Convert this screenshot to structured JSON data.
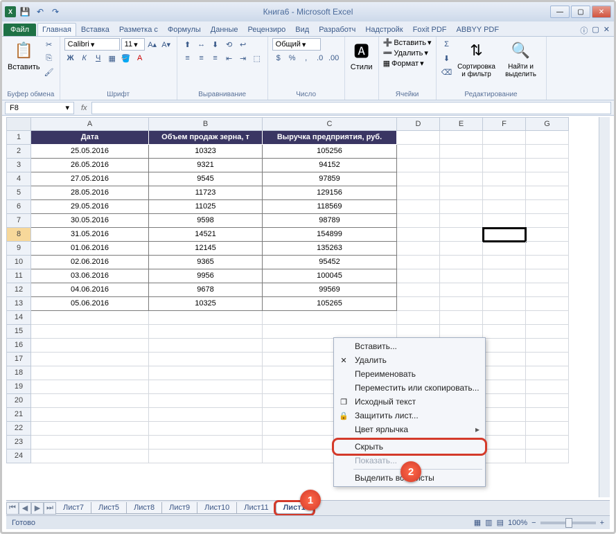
{
  "title": "Книга6 - Microsoft Excel",
  "tabs": {
    "file": "Файл",
    "list": [
      "Главная",
      "Вставка",
      "Разметка с",
      "Формулы",
      "Данные",
      "Рецензиро",
      "Вид",
      "Разработч",
      "Надстройк",
      "Foxit PDF",
      "ABBYY PDF"
    ],
    "active": 0
  },
  "ribbon": {
    "clipboard": {
      "paste": "Вставить",
      "label": "Буфер обмена"
    },
    "font": {
      "name": "Calibri",
      "size": "11",
      "label": "Шрифт",
      "bold": "Ж",
      "italic": "К",
      "underline": "Ч"
    },
    "align_label": "Выравнивание",
    "number": {
      "format": "Общий",
      "label": "Число"
    },
    "styles": {
      "btn": "Стили"
    },
    "cells": {
      "insert": "Вставить",
      "delete": "Удалить",
      "format": "Формат",
      "label": "Ячейки"
    },
    "editing": {
      "sort": "Сортировка и фильтр",
      "find": "Найти и выделить",
      "label": "Редактирование"
    }
  },
  "namebox": "F8",
  "columns": [
    "A",
    "B",
    "C",
    "D",
    "E",
    "F",
    "G"
  ],
  "headers": [
    "Дата",
    "Объем продаж зерна, т",
    "Выручка предприятия, руб."
  ],
  "rows": [
    [
      "25.05.2016",
      "10323",
      "105256"
    ],
    [
      "26.05.2016",
      "9321",
      "94152"
    ],
    [
      "27.05.2016",
      "9545",
      "97859"
    ],
    [
      "28.05.2016",
      "11723",
      "129156"
    ],
    [
      "29.05.2016",
      "11025",
      "118569"
    ],
    [
      "30.05.2016",
      "9598",
      "98789"
    ],
    [
      "31.05.2016",
      "14521",
      "154899"
    ],
    [
      "01.06.2016",
      "12145",
      "135263"
    ],
    [
      "02.06.2016",
      "9365",
      "95452"
    ],
    [
      "03.06.2016",
      "9956",
      "100045"
    ],
    [
      "04.06.2016",
      "9678",
      "99569"
    ],
    [
      "05.06.2016",
      "10325",
      "105265"
    ]
  ],
  "sheets": [
    "Лист7",
    "Лист5",
    "Лист8",
    "Лист9",
    "Лист10",
    "Лист11",
    "Лист1"
  ],
  "active_sheet": 6,
  "context": [
    {
      "t": "Вставить...",
      "i": ""
    },
    {
      "t": "Удалить",
      "i": "✕"
    },
    {
      "t": "Переименовать",
      "i": ""
    },
    {
      "t": "Переместить или скопировать...",
      "i": ""
    },
    {
      "t": "Исходный текст",
      "i": "❐"
    },
    {
      "t": "Защитить лист...",
      "i": "🔒"
    },
    {
      "t": "Цвет ярлычка",
      "i": "",
      "sub": true
    },
    {
      "t": "Скрыть",
      "i": "",
      "hl": true
    },
    {
      "t": "Показать...",
      "i": "",
      "disabled": true
    },
    {
      "t": "Выделить все листы",
      "i": ""
    }
  ],
  "status": "Готово",
  "zoom": "100%",
  "badge1": "1",
  "badge2": "2"
}
